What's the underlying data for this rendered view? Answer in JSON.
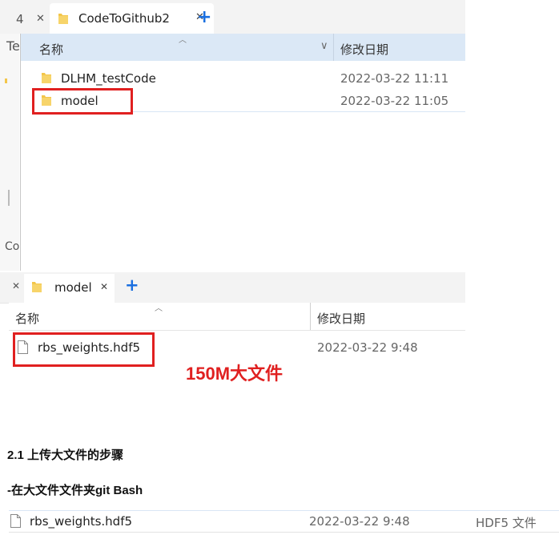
{
  "window1": {
    "prev_tab_text": "4",
    "tab_title": "CodeToGithub2",
    "left_pane_text_top": "Te",
    "left_pane_text_bottom": "Co",
    "header": {
      "name": "名称",
      "date": "修改日期"
    },
    "rows": [
      {
        "name": "DLHM_testCode",
        "date": "2022-03-22 11:11"
      },
      {
        "name": "model",
        "date": "2022-03-22 11:05"
      }
    ]
  },
  "window2": {
    "tab_title": "model",
    "header": {
      "name": "名称",
      "date": "修改日期"
    },
    "rows": [
      {
        "name": "rbs_weights.hdf5",
        "date": "2022-03-22 9:48"
      }
    ]
  },
  "annotation": "150M大文件",
  "doc": {
    "heading": "2.1 上传大文件的步骤",
    "step": "-在大文件文件夹git Bash"
  },
  "window3": {
    "row": {
      "name": "rbs_weights.hdf5",
      "date": "2022-03-22 9:48",
      "type": "HDF5 文件"
    }
  },
  "colors": {
    "highlight": "#e02020",
    "accent": "#1a6fe0",
    "folder": "#f3c64a",
    "header_bg": "#dbe8f6"
  }
}
